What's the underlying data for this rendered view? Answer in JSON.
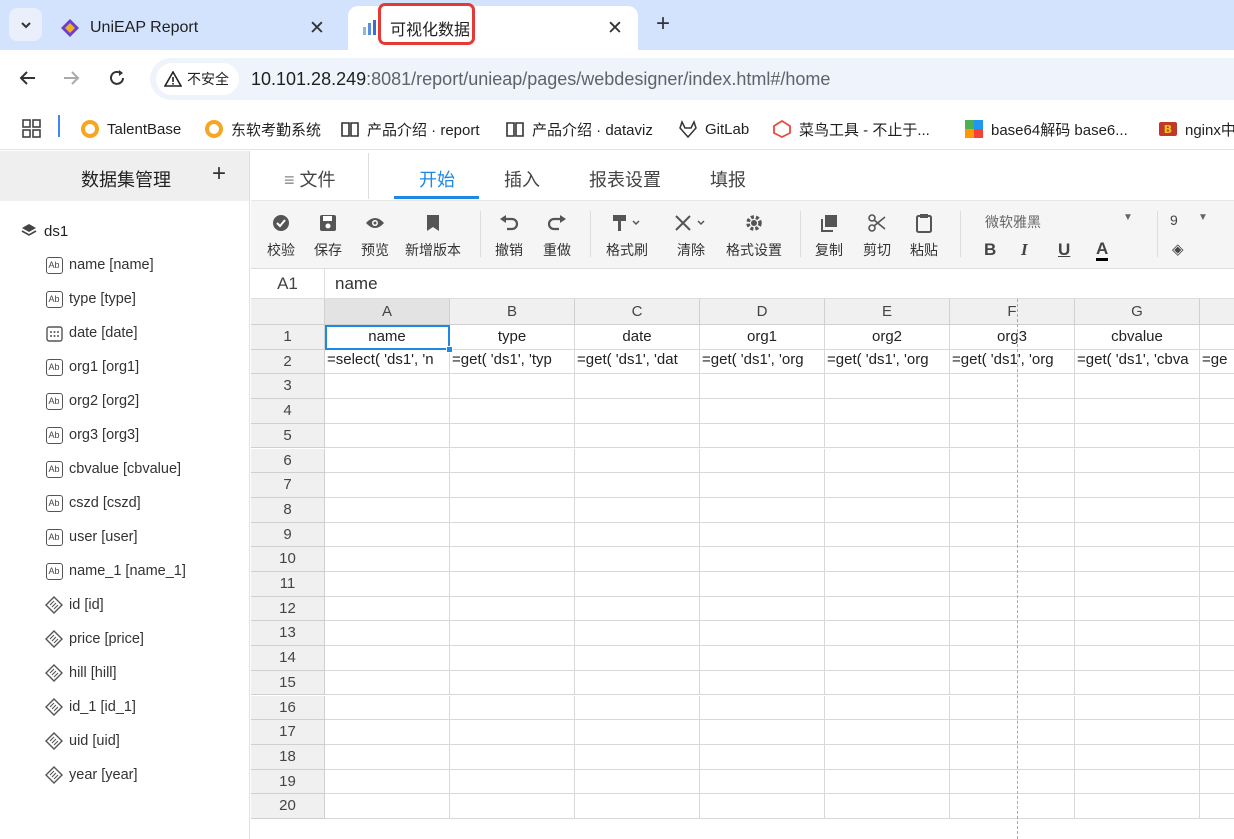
{
  "browser": {
    "tabs": [
      {
        "title": "UniEAP Report"
      },
      {
        "title": "可视化数据"
      }
    ],
    "security_label": "不安全",
    "url_host": "10.101.28.249",
    "url_rest": ":8081/report/unieap/pages/webdesigner/index.html#/home",
    "bookmarks": [
      {
        "label": "TalentBase"
      },
      {
        "label": "东软考勤系统"
      },
      {
        "label": "产品介绍 · report"
      },
      {
        "label": "产品介绍 · dataviz"
      },
      {
        "label": "GitLab"
      },
      {
        "label": "菜鸟工具 - 不止于..."
      },
      {
        "label": "base64解码 base6..."
      },
      {
        "label": "nginx中"
      }
    ]
  },
  "sidebar": {
    "title": "数据集管理",
    "add_label": "+",
    "dataset": "ds1",
    "fields": [
      {
        "label": "name [name]",
        "type": "text"
      },
      {
        "label": "type [type]",
        "type": "text"
      },
      {
        "label": "date [date]",
        "type": "date"
      },
      {
        "label": "org1 [org1]",
        "type": "text"
      },
      {
        "label": "org2 [org2]",
        "type": "text"
      },
      {
        "label": "org3 [org3]",
        "type": "text"
      },
      {
        "label": "cbvalue [cbvalue]",
        "type": "text"
      },
      {
        "label": "cszd [cszd]",
        "type": "text"
      },
      {
        "label": "user [user]",
        "type": "text"
      },
      {
        "label": "name_1 [name_1]",
        "type": "text"
      },
      {
        "label": "id [id]",
        "type": "number"
      },
      {
        "label": "price [price]",
        "type": "number"
      },
      {
        "label": "hill [hill]",
        "type": "number"
      },
      {
        "label": "id_1 [id_1]",
        "type": "number"
      },
      {
        "label": "uid [uid]",
        "type": "number"
      },
      {
        "label": "year [year]",
        "type": "number"
      }
    ]
  },
  "menu": {
    "file": "文件",
    "tabs": [
      "开始",
      "插入",
      "报表设置",
      "填报"
    ]
  },
  "toolbar": {
    "buttons": [
      "校验",
      "保存",
      "预览",
      "新增版本",
      "撤销",
      "重做",
      "格式刷",
      "清除",
      "格式设置",
      "复制",
      "剪切",
      "粘贴"
    ],
    "font_family": "微软雅黑",
    "font_size": "9"
  },
  "formula_bar": {
    "cell_ref": "A1",
    "content": "name"
  },
  "sheet": {
    "columns": [
      "A",
      "B",
      "C",
      "D",
      "E",
      "F",
      "G"
    ],
    "rows": [
      "1",
      "2",
      "3",
      "4",
      "5",
      "6",
      "7",
      "8",
      "9",
      "10",
      "11",
      "12",
      "13",
      "14",
      "15",
      "16",
      "17",
      "18",
      "19",
      "20"
    ],
    "row1": [
      "name",
      "type",
      "date",
      "org1",
      "org2",
      "org3",
      "cbvalue"
    ],
    "row2": [
      "=select( 'ds1', 'n",
      "=get( 'ds1', 'typ",
      "=get( 'ds1', 'dat",
      "=get( 'ds1', 'org",
      "=get( 'ds1', 'org",
      "=get( 'ds1', 'org",
      "=get( 'ds1', 'cbva",
      "=ge"
    ]
  }
}
